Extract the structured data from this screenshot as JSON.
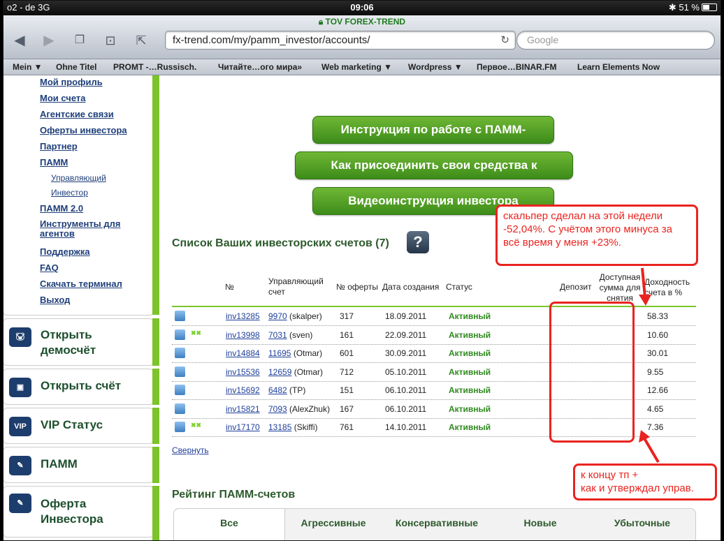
{
  "status": {
    "carrier": "o2 - de  3G",
    "time": "09:06",
    "battery": "51 %"
  },
  "browser": {
    "site_name": "TOV FOREX-TREND",
    "url": "fx-trend.com/my/pamm_investor/accounts/",
    "search_placeholder": "Google",
    "bookmarks": [
      "Mein ▼",
      "Ohne Titel",
      "PROMT -…Russisch.",
      "Читайте…ого мира»",
      "Web marketing ▼",
      "Wordpress ▼",
      "Первое…BINAR.FM",
      "Learn Elements Now"
    ]
  },
  "sidebar": {
    "menu": [
      {
        "label": "Мой профиль"
      },
      {
        "label": "Мои счета"
      },
      {
        "label": "Агентские связи"
      },
      {
        "label": "Оферты инвестора"
      },
      {
        "label": "Партнер"
      },
      {
        "label": "ПАММ"
      },
      {
        "label": "Управляющий"
      },
      {
        "label": "Инвестор"
      },
      {
        "label": "ПАММ 2.0"
      },
      {
        "label": "Инструменты для агентов"
      },
      {
        "label": "Поддержка"
      },
      {
        "label": "FAQ"
      },
      {
        "label": "Скачать терминал"
      },
      {
        "label": "Выход"
      }
    ],
    "buttons": [
      {
        "label": "Открыть демосчёт",
        "icon": "piggy-bank-icon"
      },
      {
        "label": "Открыть счёт",
        "icon": "wallet-icon"
      },
      {
        "label": "VIP Статус",
        "icon": "vip-icon"
      },
      {
        "label": "ПАММ",
        "icon": "pamm-icon"
      },
      {
        "label": "Оферта Инвестора",
        "icon": "offer-icon"
      }
    ]
  },
  "main": {
    "green_buttons": [
      "Инструкция по работе с ПАММ-",
      "Как присоединить свои средства к",
      "Видеоинструкция инвестора"
    ],
    "list_title": "Список Ваших инвесторских счетов (7)",
    "help_label": "?",
    "table": {
      "headers": {
        "num": "№",
        "manager": "Управляющий счет",
        "offer": "№ оферты",
        "created": "Дата создания",
        "status": "Статус",
        "deposit": "Депозит",
        "available": "Доступная сумма для снятия",
        "yield": "Доходность счета в %"
      },
      "rows": [
        {
          "account": "inv13285",
          "manager_id": "9970",
          "manager_name": "(skalper)",
          "offer": "317",
          "date": "18.09.2011",
          "status": "Активный",
          "yield": "58.33",
          "extra_icon": false
        },
        {
          "account": "inv13998",
          "manager_id": "7031",
          "manager_name": "(sven)",
          "offer": "161",
          "date": "22.09.2011",
          "status": "Активный",
          "yield": "10.60",
          "extra_icon": true
        },
        {
          "account": "inv14884",
          "manager_id": "11695",
          "manager_name": "(Otmar)",
          "offer": "601",
          "date": "30.09.2011",
          "status": "Активный",
          "yield": "30.01",
          "extra_icon": false
        },
        {
          "account": "inv15536",
          "manager_id": "12659",
          "manager_name": "(Otmar)",
          "offer": "712",
          "date": "05.10.2011",
          "status": "Активный",
          "yield": "9.55",
          "extra_icon": false
        },
        {
          "account": "inv15692",
          "manager_id": "6482",
          "manager_name": "(TP)",
          "offer": "151",
          "date": "06.10.2011",
          "status": "Активный",
          "yield": "12.66",
          "extra_icon": false
        },
        {
          "account": "inv15821",
          "manager_id": "7093",
          "manager_name": "(AlexZhuk)",
          "offer": "167",
          "date": "06.10.2011",
          "status": "Активный",
          "yield": "4.65",
          "extra_icon": false
        },
        {
          "account": "inv17170",
          "manager_id": "13185",
          "manager_name": "(Skiffi)",
          "offer": "761",
          "date": "14.10.2011",
          "status": "Активный",
          "yield": "7.36",
          "extra_icon": true
        }
      ]
    },
    "collapse_label": "Свернуть",
    "rating_title": "Рейтинг ПАММ-счетов",
    "rating_tabs": [
      "Все",
      "Агрессивные",
      "Консервативные",
      "Новые",
      "Убыточные"
    ]
  },
  "annotations": {
    "note_top": "скальпер сделал на этой недели -52,04%. С учётом этого минуса за всё время у меня +23%.",
    "note_bottom": "к концу тп +\nкак и утверждал управ.",
    "accent_color": "#e9231f"
  }
}
